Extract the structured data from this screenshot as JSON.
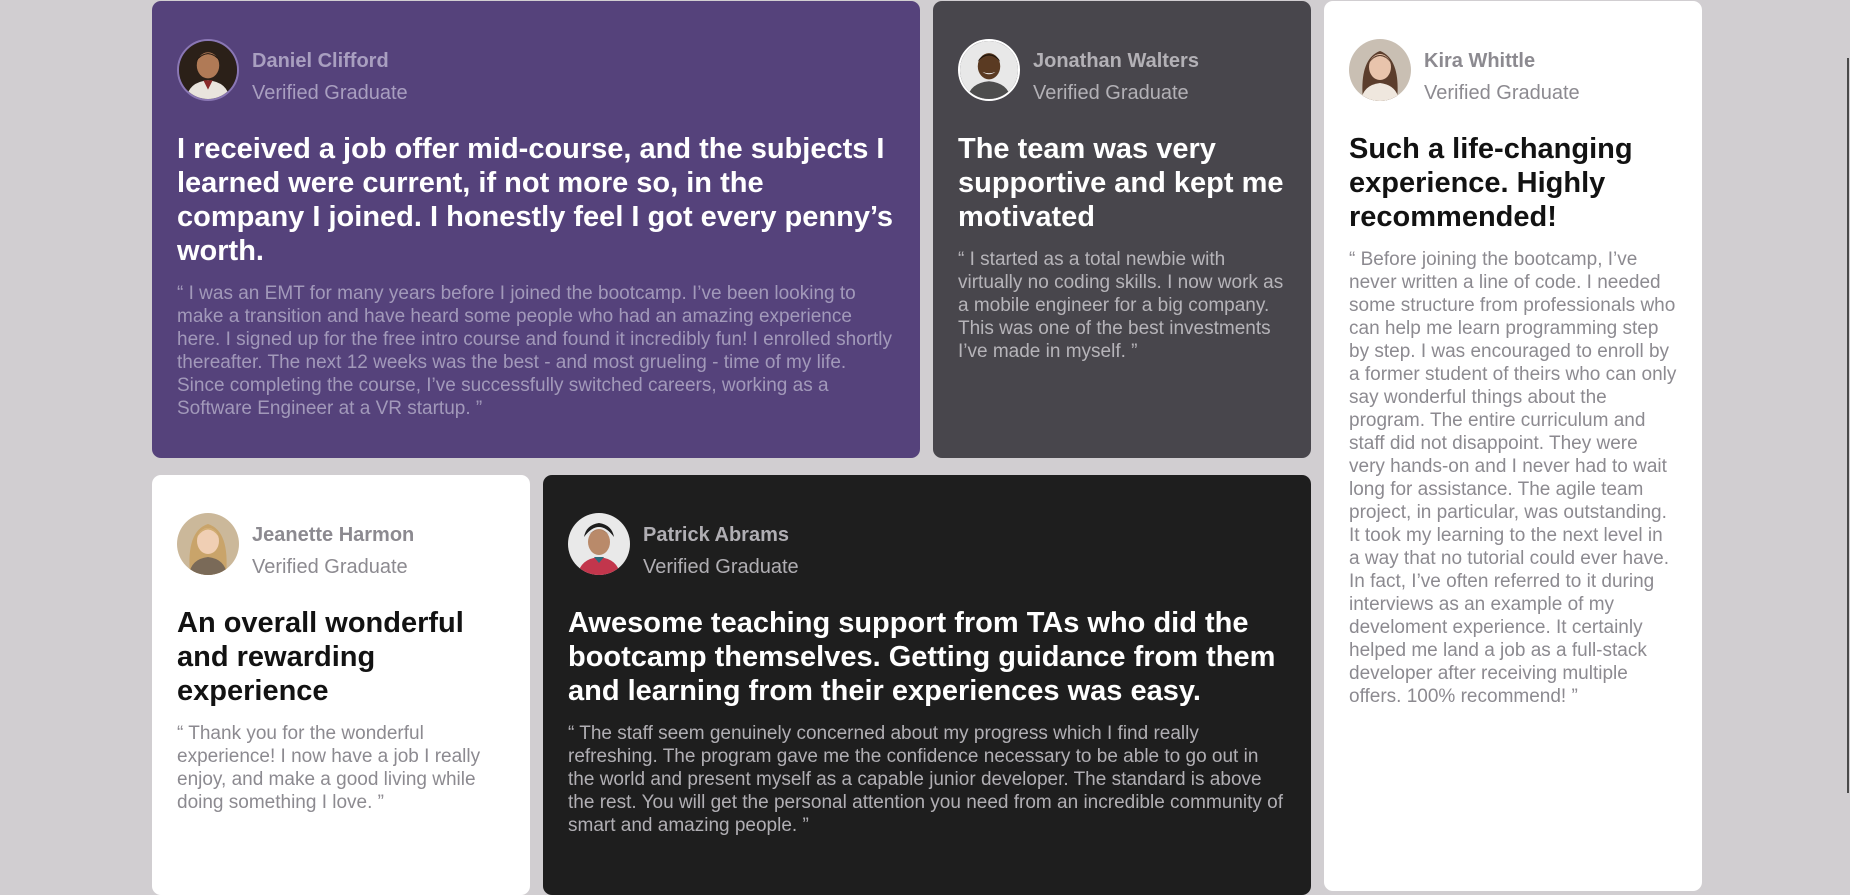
{
  "colors": {
    "page_background": "#d1ced1",
    "purple_card": "#55427b",
    "gray_card": "#48464c",
    "white_card": "#ffffff",
    "black_card": "#1e1e1e"
  },
  "testimonials": [
    {
      "name": "Daniel Clifford",
      "role": "Verified Graduate",
      "avatar_icon": "person-avatar-icon",
      "headline": "I received a job offer mid-course, and the subjects I learned were current, if not more so, in the company I joined. I honestly feel I got every penny’s worth.",
      "quote": "“ I was an EMT for many years before I joined the bootcamp. I’ve been looking to make a transition and have heard some people who had an amazing experience here. I signed up for the free intro course and found it incredibly fun! I enrolled shortly thereafter. The next 12 weeks was the best - and most grueling - time of my life. Since completing the course, I’ve successfully switched careers, working as a Software Engineer at a VR startup. ”"
    },
    {
      "name": "Jonathan Walters",
      "role": "Verified Graduate",
      "avatar_icon": "person-avatar-icon",
      "headline": "The team was very supportive and kept me motivated",
      "quote": "“ I started as a total newbie with virtually no coding skills. I now work as a mobile engineer for a big company. This was one of the best investments I’ve made in myself. ”"
    },
    {
      "name": "Kira Whittle",
      "role": "Verified Graduate",
      "avatar_icon": "person-avatar-icon",
      "headline": "Such a life-changing experience. Highly recommended!",
      "quote": "“ Before joining the bootcamp, I’ve never written a line of code. I needed some structure from professionals who can help me learn programming step by step. I was encouraged to enroll by a former student of theirs who can only say wonderful things about the program. The entire curriculum and staff did not disappoint. They were very hands-on and I never had to wait long for assistance. The agile team project, in particular, was outstanding. It took my learning to the next level in a way that no tutorial could ever have. In fact, I’ve often referred to it during interviews as an example of my develoment experience. It certainly helped me land a job as a full-stack developer after receiving multiple offers. 100% recommend! ”"
    },
    {
      "name": "Jeanette Harmon",
      "role": "Verified Graduate",
      "avatar_icon": "person-avatar-icon",
      "headline": "An overall wonderful and rewarding experience",
      "quote": "“ Thank you for the wonderful experience! I now have a job I really enjoy, and make a good living while doing something I love. ”"
    },
    {
      "name": "Patrick Abrams",
      "role": "Verified Graduate",
      "avatar_icon": "person-avatar-icon",
      "headline": "Awesome teaching support from TAs who did the bootcamp themselves. Getting guidance from them and learning from their experiences was easy.",
      "quote": "“ The staff seem genuinely concerned about my progress which I find really refreshing. The program gave me the confidence necessary to be able to go out in the world and present myself as a capable junior developer. The standard is above the rest. You will get the personal attention you need from an incredible community of smart and amazing people. ”"
    }
  ]
}
